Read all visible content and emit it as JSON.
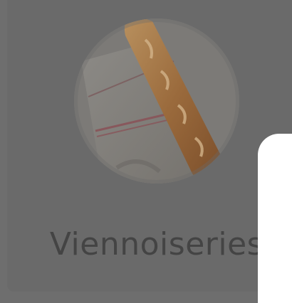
{
  "category": {
    "label": "Viennoiseries",
    "image_subject": "baguette-on-linen-towel"
  },
  "colors": {
    "overlay": "#6e6e6e",
    "label_text": "#444444",
    "panel": "#ffffff"
  }
}
